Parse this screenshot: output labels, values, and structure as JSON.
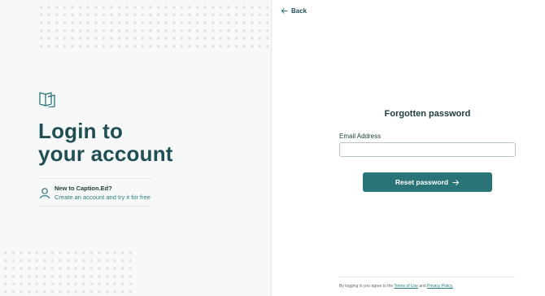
{
  "left_panel": {
    "heading_line1": "Login to",
    "heading_line2": "your account",
    "signup_title": "New to Caption.Ed?",
    "signup_link": "Create an account and try it for free",
    "logo_icon": "book-logo-icon",
    "user_icon": "user-icon"
  },
  "right_panel": {
    "back_label": "Back",
    "title": "Forgotten password",
    "email_label": "Email Address",
    "email_value": "",
    "reset_button": "Reset password",
    "footer_prefix": "By logging in you agree to the",
    "terms_link": "Terms of Use",
    "footer_and": "and",
    "privacy_link": "Privacy Policy."
  },
  "colors": {
    "accent": "#2a7377",
    "heading": "#1f4f55",
    "left_bg": "#f7f8f8"
  }
}
